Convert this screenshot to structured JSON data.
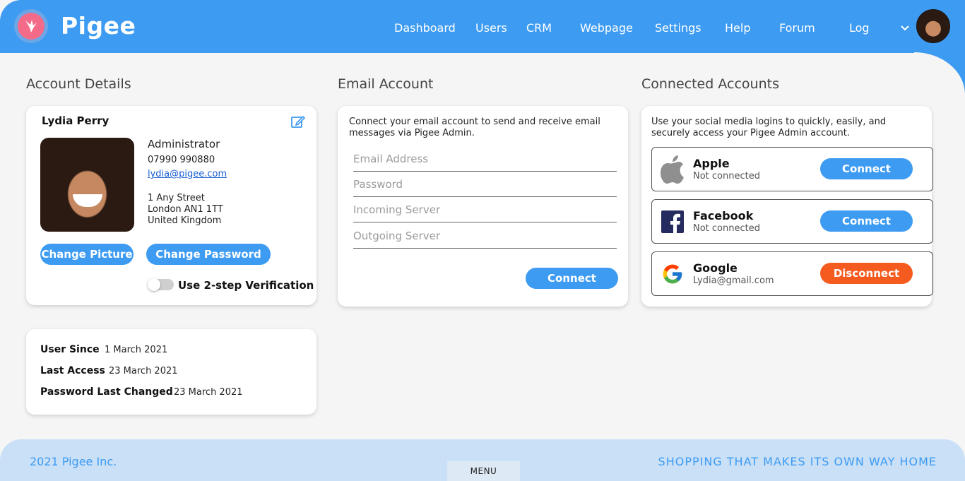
{
  "brand": "Pigee",
  "nav": {
    "items": [
      "Dashboard",
      "Users",
      "CRM",
      "Webpage",
      "Settings",
      "Help",
      "Forum",
      "Log"
    ]
  },
  "account": {
    "title": "Account Details",
    "name": "Lydia Perry",
    "role": "Administrator",
    "phone": "07990 990880",
    "email": "lydia@pigee.com",
    "address": [
      "1 Any Street",
      "London AN1 1TT",
      "United Kingdom"
    ],
    "change_picture": "Change Picture",
    "change_password": "Change Password",
    "two_step": "Use 2-step Verification"
  },
  "meta": {
    "user_since_label": "User Since",
    "user_since": "1 March 2021",
    "last_access_label": "Last Access",
    "last_access": "23 March 2021",
    "pwd_changed_label": "Password Last Changed",
    "pwd_changed": "23 March 2021"
  },
  "email": {
    "title": "Email Account",
    "intro": "Connect your email account to send and receive email messages via Pigee Admin.",
    "fields": {
      "address": "Email Address",
      "password": "Password",
      "incoming": "Incoming Server",
      "outgoing": "Outgoing Server"
    },
    "connect": "Connect"
  },
  "connected": {
    "title": "Connected Accounts",
    "intro": "Use your social media logins to quickly, easily, and securely access your Pigee Admin account.",
    "accounts": [
      {
        "name": "Apple",
        "status": "Not connected",
        "action": "Connect",
        "icon": "apple-icon"
      },
      {
        "name": "Facebook",
        "status": "Not connected",
        "action": "Connect",
        "icon": "facebook-icon"
      },
      {
        "name": "Google",
        "status": "Lydia@gmail.com",
        "action": "Disconnect",
        "icon": "google-icon"
      }
    ]
  },
  "footer": {
    "copyright": "2021 Pigee Inc.",
    "menu": "MENU",
    "tagline": "SHOPPING THAT MAKES ITS OWN WAY HOME"
  },
  "colors": {
    "primary": "#3d9bf2",
    "danger": "#f55b1e",
    "footer_bg": "#c9e0f7"
  }
}
